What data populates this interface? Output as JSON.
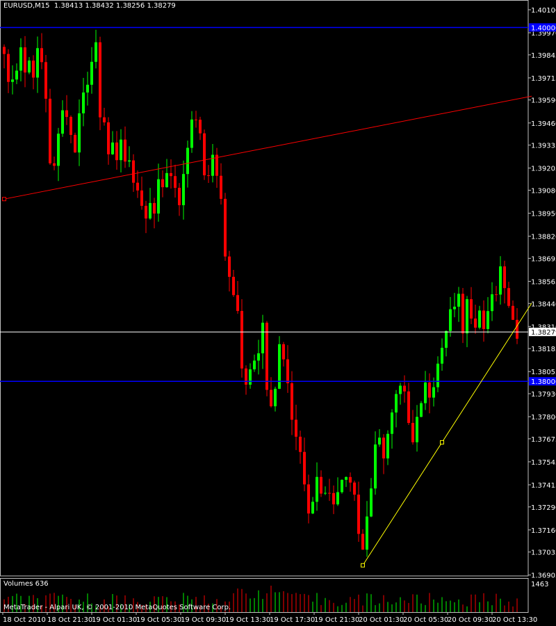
{
  "header": {
    "symbol": "EURUSD,M15",
    "ohlc": "1.38413 1.38432 1.38256 1.38279"
  },
  "volume_panel": {
    "label": "Volumes 636",
    "max_label": "1463"
  },
  "copyright": "MetaTrader - Alpari UK, © 2001-2010 MetaQuotes Software Corp.",
  "colors": {
    "background": "#000000",
    "bull": "#00ff00",
    "bear": "#ff0000",
    "hline": "#0000ff",
    "trend_red": "#ff0000",
    "trend_yellow": "#ffff00",
    "price_line": "#ffffff"
  },
  "chart_data": {
    "type": "candlestick",
    "symbol": "EURUSD",
    "timeframe": "M15",
    "ylim": [
      1.369,
      1.401
    ],
    "price_ticks": [
      "1.40100",
      "1.39970",
      "1.39845",
      "1.39715",
      "1.39590",
      "1.39460",
      "1.39335",
      "1.39205",
      "1.39080",
      "1.38950",
      "1.38820",
      "1.38695",
      "1.38565",
      "1.38440",
      "1.38310",
      "1.38185",
      "1.38055",
      "1.37930",
      "1.37800",
      "1.37675",
      "1.37545",
      "1.37415",
      "1.37290",
      "1.37160",
      "1.37035",
      "1.36905"
    ],
    "time_labels": [
      "18 Oct 2010",
      "18 Oct 21:30",
      "19 Oct 01:30",
      "19 Oct 05:30",
      "19 Oct 09:30",
      "19 Oct 13:30",
      "19 Oct 17:30",
      "19 Oct 21:30",
      "20 Oct 01:30",
      "20 Oct 05:30",
      "20 Oct 09:30",
      "20 Oct 13:30"
    ],
    "current_price": "1.38279",
    "horizontal_lines": [
      {
        "price": 1.4,
        "label": "1.40000"
      },
      {
        "price": 1.38,
        "label": "1.38000"
      }
    ],
    "trendlines": [
      {
        "color": "red",
        "start_index": 0,
        "start_price": 1.3903,
        "end_index": 124,
        "end_price": 1.396
      },
      {
        "color": "yellow",
        "start_index": 86,
        "start_price": 1.3696,
        "end_index": 124,
        "end_price": 1.3835
      }
    ],
    "anchor_prices": [
      1.399,
      1.3965,
      1.3975,
      1.3975,
      1.399,
      1.3975,
      1.398,
      1.3975,
      1.399,
      1.398,
      1.3955,
      1.392,
      1.3925,
      1.3935,
      1.395,
      1.395,
      1.3935,
      1.393,
      1.395,
      1.3965,
      1.3965,
      1.398,
      1.399,
      1.395,
      1.395,
      1.393,
      1.3935,
      1.393,
      1.394,
      1.3925,
      1.392,
      1.391,
      1.391,
      1.39,
      1.3895,
      1.39,
      1.389,
      1.391,
      1.391,
      1.3915,
      1.3915,
      1.3905,
      1.39,
      1.392,
      1.393,
      1.3945,
      1.395,
      1.394,
      1.392,
      1.392,
      1.393,
      1.392,
      1.39,
      1.387,
      1.386,
      1.3845,
      1.384,
      1.381,
      1.38,
      1.381,
      1.3815,
      1.382,
      1.383,
      1.38,
      1.379,
      1.38,
      1.382,
      1.3815,
      1.38,
      1.378,
      1.377,
      1.376,
      1.3745,
      1.373,
      1.3735,
      1.3745,
      1.374,
      1.3735,
      1.374,
      1.3735,
      1.3735,
      1.3745,
      1.375,
      1.3745,
      1.374,
      1.3715,
      1.3705,
      1.3725,
      1.374,
      1.376,
      1.3765,
      1.376,
      1.377,
      1.378,
      1.379,
      1.3795,
      1.379,
      1.378,
      1.377,
      1.378,
      1.379,
      1.3795,
      1.3795,
      1.38,
      1.381,
      1.3815,
      1.383,
      1.384,
      1.384,
      1.3845,
      1.383,
      1.3845,
      1.384,
      1.3835,
      1.384,
      1.383,
      1.384,
      1.3845,
      1.385,
      1.386,
      1.3855,
      1.384,
      1.383,
      1.3828
    ],
    "volume_range": [
      0,
      1463
    ],
    "last_volume": 636
  }
}
